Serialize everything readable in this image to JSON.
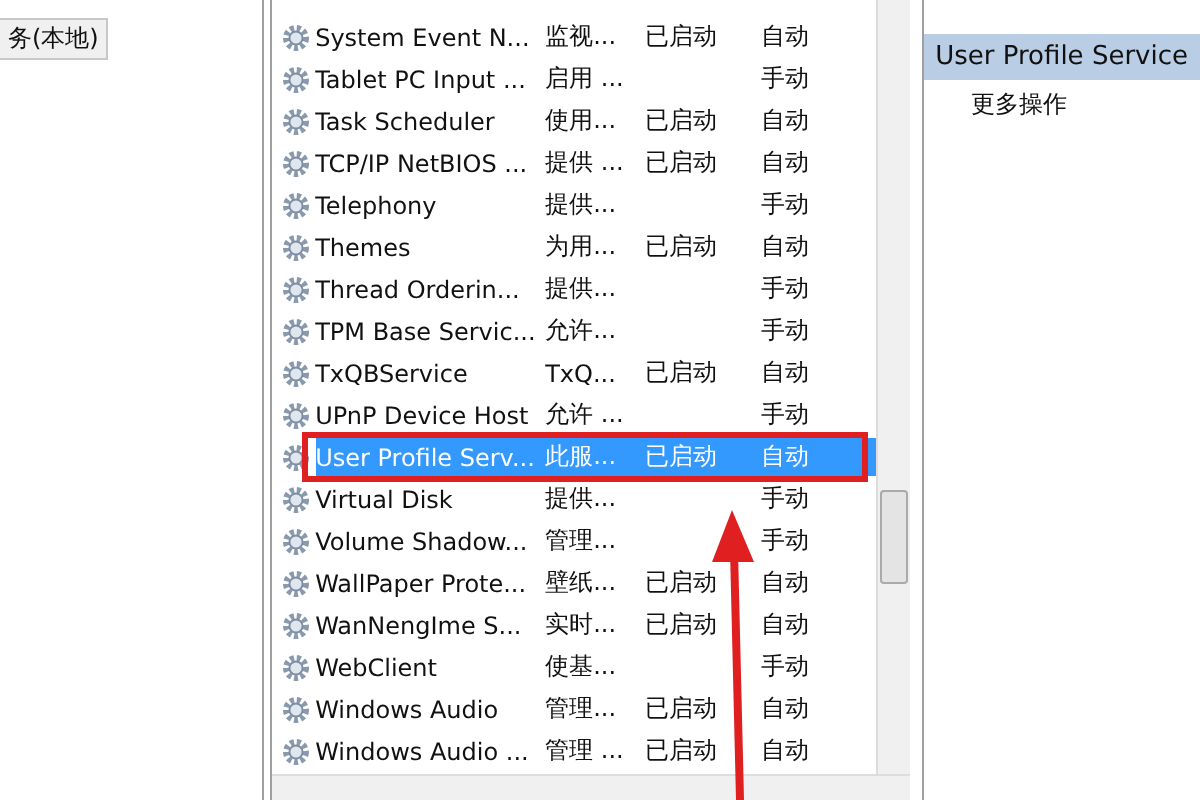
{
  "left_panel": {
    "tab": "务(本地)"
  },
  "services": [
    {
      "name": "System Event N...",
      "description": "监视...",
      "status": "已启动",
      "startup": "自动",
      "selected": false,
      "highlighted": false
    },
    {
      "name": "Tablet PC Input ...",
      "description": "启用 ...",
      "startup": "手动",
      "selected": false,
      "highlighted": false
    },
    {
      "name": "Task Scheduler",
      "description": "使用...",
      "status": "已启动",
      "startup": "自动",
      "selected": false,
      "highlighted": false
    },
    {
      "name": "TCP/IP NetBIOS ...",
      "description": "提供 ...",
      "status": "已启动",
      "startup": "自动",
      "selected": false,
      "highlighted": false
    },
    {
      "name": "Telephony",
      "description": "提供...",
      "startup": "手动",
      "selected": false,
      "highlighted": false
    },
    {
      "name": "Themes",
      "description": "为用...",
      "status": "已启动",
      "startup": "自动",
      "selected": false,
      "highlighted": false
    },
    {
      "name": "Thread Orderin...",
      "description": "提供...",
      "startup": "手动",
      "selected": false,
      "highlighted": false
    },
    {
      "name": "TPM Base Servic...",
      "description": "允许...",
      "startup": "手动",
      "selected": false,
      "highlighted": false
    },
    {
      "name": "TxQBService",
      "description": "TxQ...",
      "status": "已启动",
      "startup": "自动",
      "selected": false,
      "highlighted": false
    },
    {
      "name": "UPnP Device Host",
      "description": "允许 ...",
      "startup": "手动",
      "selected": false,
      "highlighted": false
    },
    {
      "name": "User Profile Serv...",
      "description": "此服...",
      "status": "已启动",
      "startup": "自动",
      "selected": true,
      "highlighted": true
    },
    {
      "name": "Virtual Disk",
      "description": "提供...",
      "startup": "手动",
      "selected": false,
      "highlighted": false
    },
    {
      "name": "Volume Shadow...",
      "description": "管理...",
      "startup": "手动",
      "selected": false,
      "highlighted": false
    },
    {
      "name": "WallPaper Prote...",
      "description": "壁纸...",
      "status": "已启动",
      "startup": "自动",
      "selected": false,
      "highlighted": false
    },
    {
      "name": "WanNengIme S...",
      "description": "实时...",
      "status": "已启动",
      "startup": "自动",
      "selected": false,
      "highlighted": false
    },
    {
      "name": "WebClient",
      "description": "使基...",
      "startup": "手动",
      "selected": false,
      "highlighted": false
    },
    {
      "name": "Windows Audio",
      "description": "管理...",
      "status": "已启动",
      "startup": "自动",
      "selected": false,
      "highlighted": false
    },
    {
      "name": "Windows Audio ...",
      "description": "管理 ...",
      "status": "已启动",
      "startup": "自动",
      "selected": false,
      "highlighted": false
    }
  ],
  "actions_panel": {
    "header": "User Profile Service",
    "items": [
      "更多操作"
    ]
  }
}
